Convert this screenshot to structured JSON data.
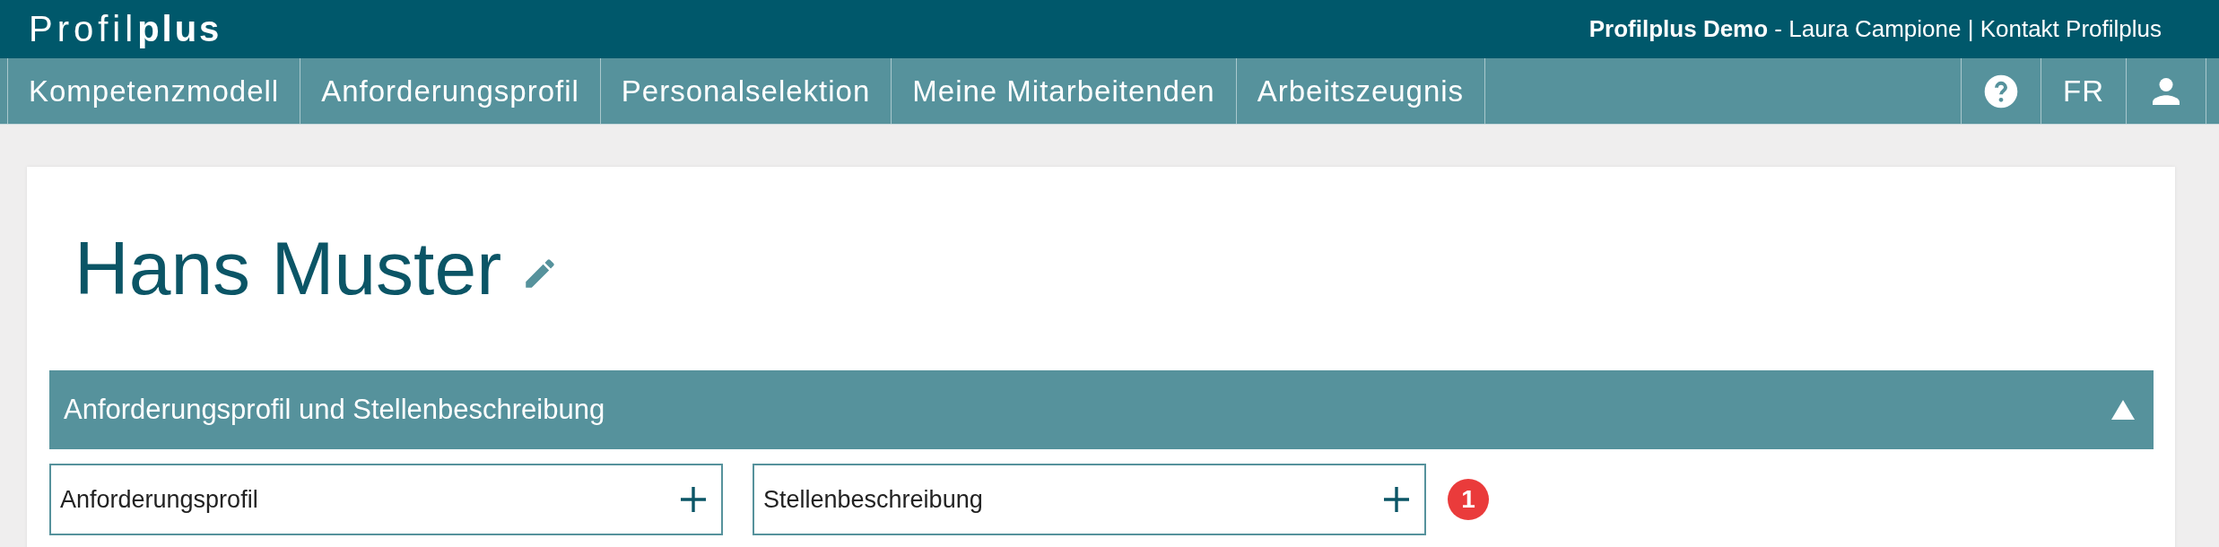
{
  "header": {
    "logo_light": "Profil",
    "logo_bold": "plus",
    "account_bold": "Profilplus Demo",
    "account_rest": " - Laura Campione | Kontakt Profilplus"
  },
  "nav": {
    "items": [
      {
        "label": "Kompetenzmodell",
        "selected": false
      },
      {
        "label": "Anforderungsprofil",
        "selected": false
      },
      {
        "label": "Personalselektion",
        "selected": false
      },
      {
        "label": "Meine Mitarbeitenden",
        "selected": false
      },
      {
        "label": "Arbeitszeugnis",
        "selected": false
      }
    ],
    "language": "FR"
  },
  "person": {
    "name": "Hans Muster"
  },
  "section": {
    "title": "Anforderungsprofil und Stellenbeschreibung",
    "expanded": true,
    "documents": [
      {
        "label": "Anforderungsprofil"
      },
      {
        "label": "Stellenbeschreibung",
        "badge": "1"
      }
    ]
  }
}
